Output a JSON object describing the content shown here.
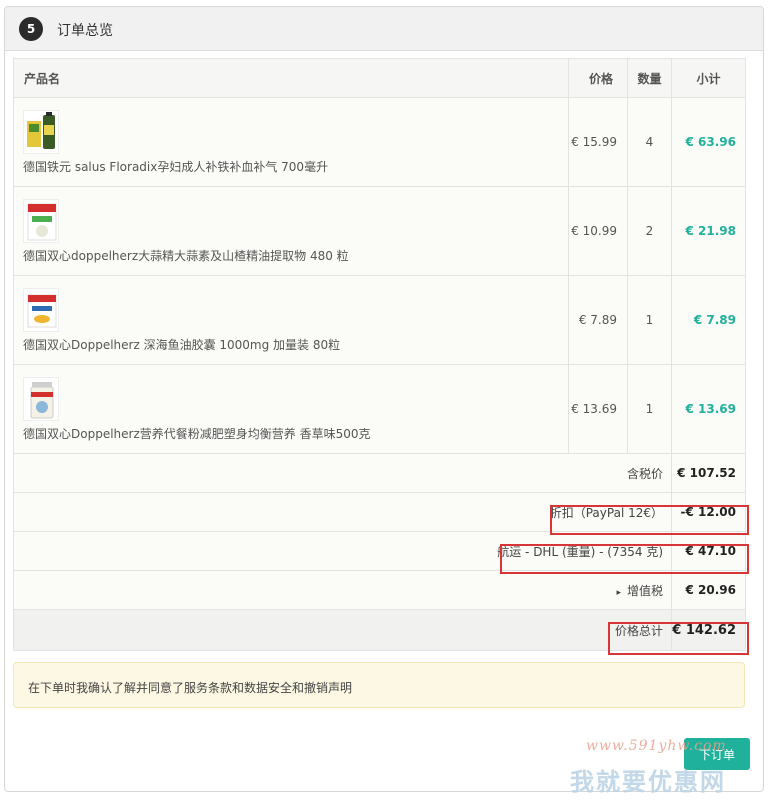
{
  "header": {
    "step": "5",
    "title": "订单总览"
  },
  "table": {
    "columns": {
      "name": "产品名",
      "price": "价格",
      "qty": "数量",
      "subtotal": "小计"
    },
    "items": [
      {
        "name": "德国铁元 salus Floradix孕妇成人补铁补血补气 700毫升",
        "price": "€ 15.99",
        "qty": "4",
        "subtotal": "€ 63.96",
        "image": "floradix-product-image"
      },
      {
        "name": "德国双心doppelherz大蒜精大蒜素及山楂精油提取物 480 粒",
        "price": "€ 10.99",
        "qty": "2",
        "subtotal": "€ 21.98",
        "image": "doppelherz-garlic-product-image"
      },
      {
        "name": "德国双心Doppelherz 深海鱼油胶囊 1000mg 加量装 80粒",
        "price": "€ 7.89",
        "qty": "1",
        "subtotal": "€ 7.89",
        "image": "doppelherz-omega3-product-image"
      },
      {
        "name": "德国双心Doppelherz营养代餐粉减肥塑身均衡营养 香草味500克",
        "price": "€ 13.69",
        "qty": "1",
        "subtotal": "€ 13.69",
        "image": "doppelherz-meal-powder-product-image"
      }
    ],
    "totals": {
      "incl_tax_label": "含税价",
      "incl_tax_value": "€ 107.52",
      "discount_label": "折扣（PayPal 12€）",
      "discount_value": "-€ 12.00",
      "shipping_label": "航运 - DHL (重量) - (7354 克)",
      "shipping_value": "€ 47.10",
      "vat_label": "增值税",
      "vat_value": "€ 20.96",
      "grand_label": "价格总计",
      "grand_value": "€ 142.62"
    }
  },
  "notice": "在下单时我确认了解并同意了服务条款和数据安全和撤销声明",
  "place_order_label": "下订单",
  "watermark": {
    "url": "www.591yhw.com",
    "text": "我就要优惠网"
  },
  "colors": {
    "accent": "#1fb19b",
    "highlight": "#d83636",
    "notice_bg": "#fcf8e3"
  }
}
